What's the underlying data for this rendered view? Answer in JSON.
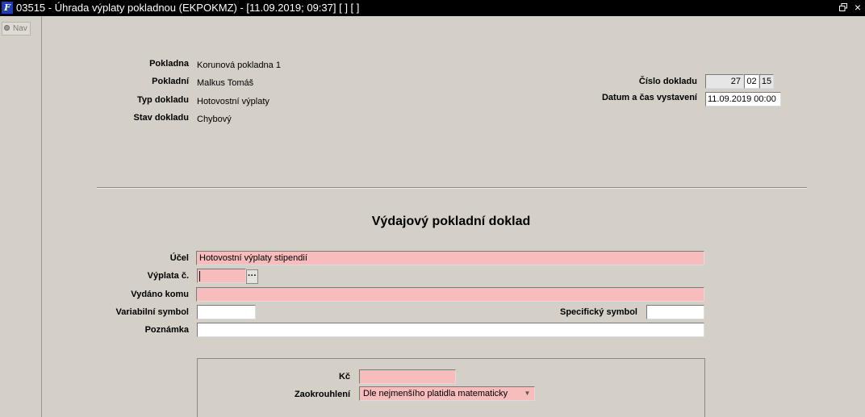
{
  "window": {
    "title": "03515 - Úhrada výplaty pokladnou (EKPOKMZ) - [11.09.2019; 09:37]  [ ]  [ ]",
    "icon": "app-logo-icon"
  },
  "nav": {
    "label": "Nav"
  },
  "header": {
    "pokladna_label": "Pokladna",
    "pokladna_value": "Korunová pokladna 1",
    "pokladni_label": "Pokladní",
    "pokladni_value": "Malkus Tomáš",
    "typ_label": "Typ dokladu",
    "typ_value": "Hotovostní výplaty",
    "stav_label": "Stav dokladu",
    "stav_value": "Chybový",
    "cislo_label": "Číslo dokladu",
    "cislo_1": "27",
    "cislo_2": "02",
    "cislo_3": "15",
    "datum_label": "Datum a čas vystavení",
    "datum_value": "11.09.2019 00:00"
  },
  "form": {
    "heading": "Výdajový pokladní doklad",
    "ucel_label": "Účel",
    "ucel_value": "Hotovostní výplaty stipendií",
    "vyplata_label": "Výplata č.",
    "vyplata_value": "",
    "lov_label": "···",
    "vydano_label": "Vydáno komu",
    "vydano_value": "",
    "vs_label": "Variabilní symbol",
    "vs_value": "",
    "ss_label": "Specifický symbol",
    "ss_value": "",
    "poznamka_label": "Poznámka",
    "poznamka_value": "",
    "kc_label": "Kč",
    "kc_value": "",
    "zaokrouhleni_label": "Zaokrouhlení",
    "zaokrouhleni_value": "Dle nejmenšího platidla matematicky"
  },
  "colors": {
    "required_field": "#f7bcbc",
    "titlebar": "#000000",
    "background": "#d4d0c8"
  }
}
